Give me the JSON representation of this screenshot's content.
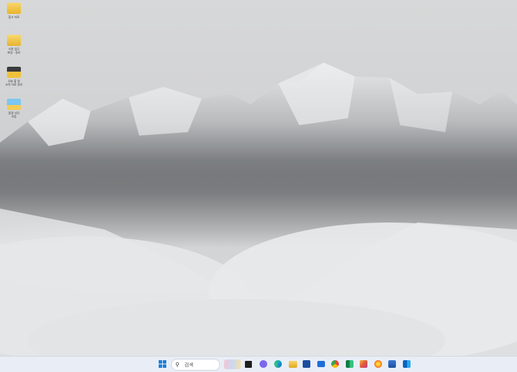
{
  "desktop": {
    "icons": [
      {
        "label": "참고 자료",
        "name": "desktop-icon-folder-1"
      },
      {
        "label": "기관 업무\n파일 - 정리",
        "name": "desktop-icon-folder-2"
      },
      {
        "label": "오늘 할 일\n교육 자료 정리",
        "name": "desktop-icon-archive"
      },
      {
        "label": "풍경 사진\n모음",
        "name": "desktop-icon-photos"
      }
    ]
  },
  "taskbar": {
    "search_placeholder": "검색",
    "apps": [
      "widgets-news-icon",
      "task-view-icon",
      "chat-icon",
      "edge-icon",
      "file-explorer-icon",
      "microsoft-store-icon",
      "mail-icon",
      "chrome-icon",
      "excel-icon",
      "pen-app-icon",
      "firefox-icon",
      "network-app-icon",
      "outlook-icon"
    ]
  }
}
